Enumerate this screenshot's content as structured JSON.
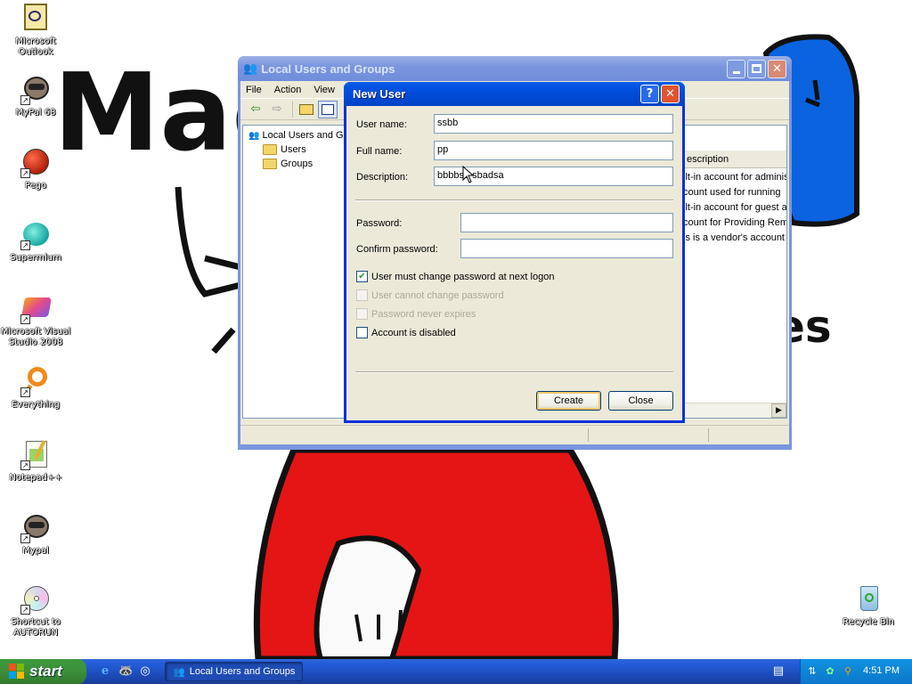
{
  "desktop": {
    "icons": [
      {
        "label": "Microsoft Outlook",
        "icon": "outlook-icon"
      },
      {
        "label": "MyPal 68",
        "icon": "raccoon-icon"
      },
      {
        "label": "Pego",
        "icon": "pego-icon"
      },
      {
        "label": "Supermium",
        "icon": "supermium-icon"
      },
      {
        "label": "Microsoft Visual Studio 2008",
        "icon": "visual-studio-icon"
      },
      {
        "label": "Everything",
        "icon": "search-icon"
      },
      {
        "label": "Notepad++",
        "icon": "notepad-icon"
      },
      {
        "label": "Mypal",
        "icon": "raccoon-icon"
      },
      {
        "label": "Shortcut to AUTORUN",
        "icon": "cd-icon"
      }
    ],
    "recycle_bin": {
      "label": "Recycle Bin",
      "icon": "recycle-bin-icon"
    },
    "wallpaper_text": {
      "left": "Mac",
      "right": "es"
    }
  },
  "mmc_window": {
    "title": "Local Users and Groups",
    "menu": [
      "File",
      "Action",
      "View"
    ],
    "tree": {
      "root": "Local Users and Gr",
      "children": [
        "Users",
        "Groups"
      ]
    },
    "list_header": "escription",
    "rows": [
      "ilt-in account for adminis",
      "count used for running",
      "ilt-in account for guest a",
      "count for Providing Rem",
      "is is a vendor's account"
    ]
  },
  "new_user_dialog": {
    "title": "New User",
    "help_button": "?",
    "close_button": "✕",
    "fields": {
      "user_name_label": "User name:",
      "user_name_value": "ssbb",
      "full_name_label": "Full name:",
      "full_name_value": "pp",
      "description_label": "Description:",
      "description_value": "bbbbsa sbadsa",
      "password_label": "Password:",
      "password_value": "",
      "confirm_label": "Confirm password:",
      "confirm_value": ""
    },
    "checkboxes": [
      {
        "label": "User must change password at next logon",
        "checked": true,
        "enabled": true
      },
      {
        "label": "User cannot change password",
        "checked": false,
        "enabled": false
      },
      {
        "label": "Password never expires",
        "checked": false,
        "enabled": false
      },
      {
        "label": "Account is disabled",
        "checked": false,
        "enabled": true
      }
    ],
    "buttons": {
      "create": "Create",
      "close": "Close"
    }
  },
  "taskbar": {
    "start_label": "start",
    "task_button": "Local Users and Groups",
    "clock": "4:51 PM"
  }
}
